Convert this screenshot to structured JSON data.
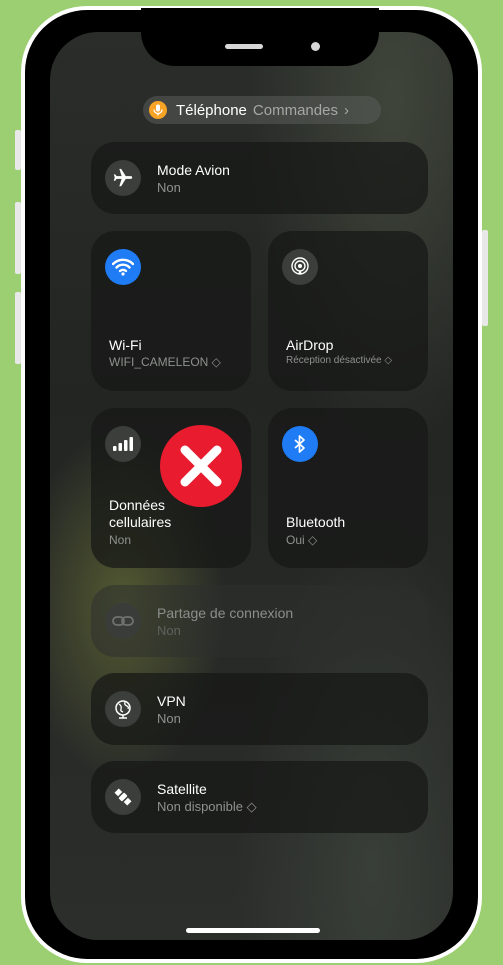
{
  "status_pill": {
    "app": "Téléphone",
    "subtitle": "Commandes",
    "chevron": "›",
    "icon": "microphone-icon",
    "icon_color": "#f7a325"
  },
  "airplane": {
    "title": "Mode Avion",
    "status": "Non",
    "icon": "airplane-icon"
  },
  "wifi": {
    "title": "Wi-Fi",
    "network": "WIFI_CAMELEON ◇",
    "icon": "wifi-icon",
    "active_color": "#1f7cf5"
  },
  "airdrop": {
    "title": "AirDrop",
    "status": "Réception désactivée ◇",
    "icon": "airdrop-icon"
  },
  "cellular": {
    "title_line1": "Données",
    "title_line2": "cellulaires",
    "status": "Non",
    "icon": "cellular-signal-icon"
  },
  "bluetooth": {
    "title": "Bluetooth",
    "status": "Oui ◇",
    "icon": "bluetooth-icon",
    "active_color": "#1f7cf5"
  },
  "hotspot": {
    "title": "Partage de connexion",
    "status": "Non",
    "icon": "personal-hotspot-icon"
  },
  "vpn": {
    "title": "VPN",
    "status": "Non",
    "icon": "vpn-globe-icon"
  },
  "satellite": {
    "title": "Satellite",
    "status": "Non disponible ◇",
    "icon": "satellite-icon"
  },
  "overlay": {
    "icon": "red-x-icon",
    "color": "#e81c2e"
  }
}
